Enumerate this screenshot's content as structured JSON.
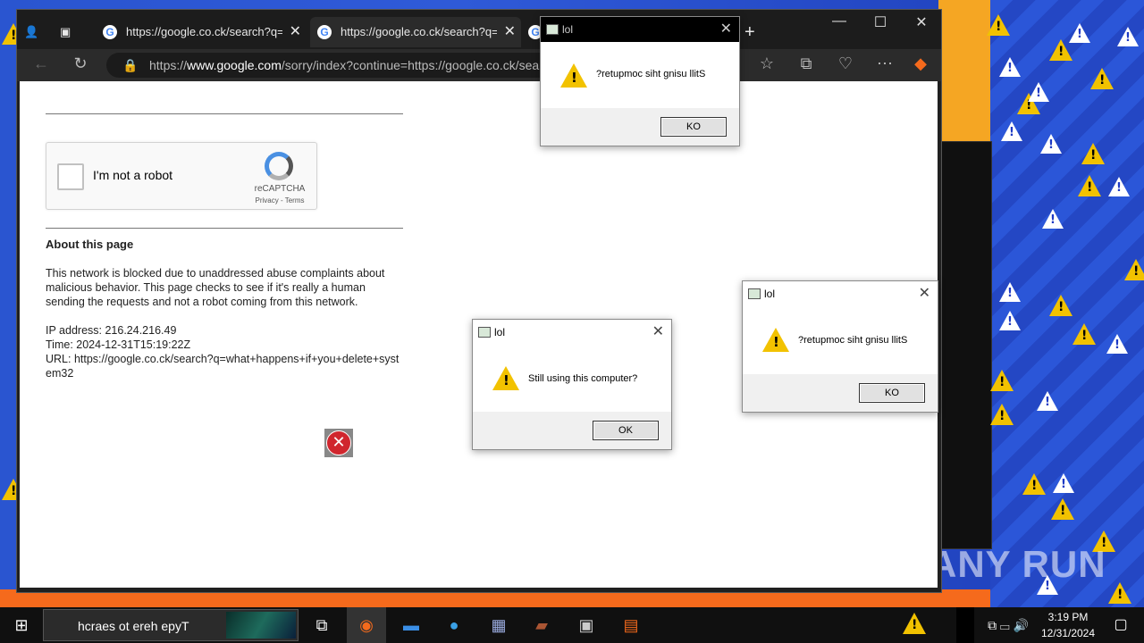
{
  "browser": {
    "tabs": [
      {
        "title": "https://google.co.ck/search?q=d"
      },
      {
        "title": "https://google.co.ck/search?q=h"
      }
    ],
    "address": {
      "prefix": "https://",
      "host": "www.google.com",
      "path": "/sorry/index?continue=https://google.co.ck/sear"
    },
    "window_controls": {
      "minimize": "—",
      "maximize": "☐",
      "close": "✕"
    }
  },
  "page": {
    "captcha": {
      "label": "I'm not a robot",
      "brand": "reCAPTCHA",
      "links": "Privacy - Terms"
    },
    "about_heading": "About this page",
    "about_text": "This network is blocked due to unaddressed abuse complaints about malicious behavior. This page checks to see if it's really a human sending the requests and not a robot coming from this network.",
    "ip": "IP address: 216.24.216.49",
    "time": "Time: 2024-12-31T15:19:22Z",
    "url": "URL: https://google.co.ck/search?q=what+happens+if+you+delete+system32"
  },
  "dialogs": [
    {
      "title": "lol",
      "message": "?retupmoc siht gnisu llitS",
      "button": "KO"
    },
    {
      "title": "lol",
      "message": "Still using this computer?",
      "button": "OK"
    },
    {
      "title": "lol",
      "message": "?retupmoc siht gnisu llitS",
      "button": "KO"
    }
  ],
  "taskbar": {
    "search_placeholder": "hcraes ot ereh epyT",
    "time": "3:19 PM",
    "date": "12/31/2024"
  },
  "watermark": "ANY RUN",
  "colors": {
    "desktop_blue": "#2a55d0",
    "warning_yellow": "#f2c200",
    "accent_orange": "#f56a1c"
  }
}
